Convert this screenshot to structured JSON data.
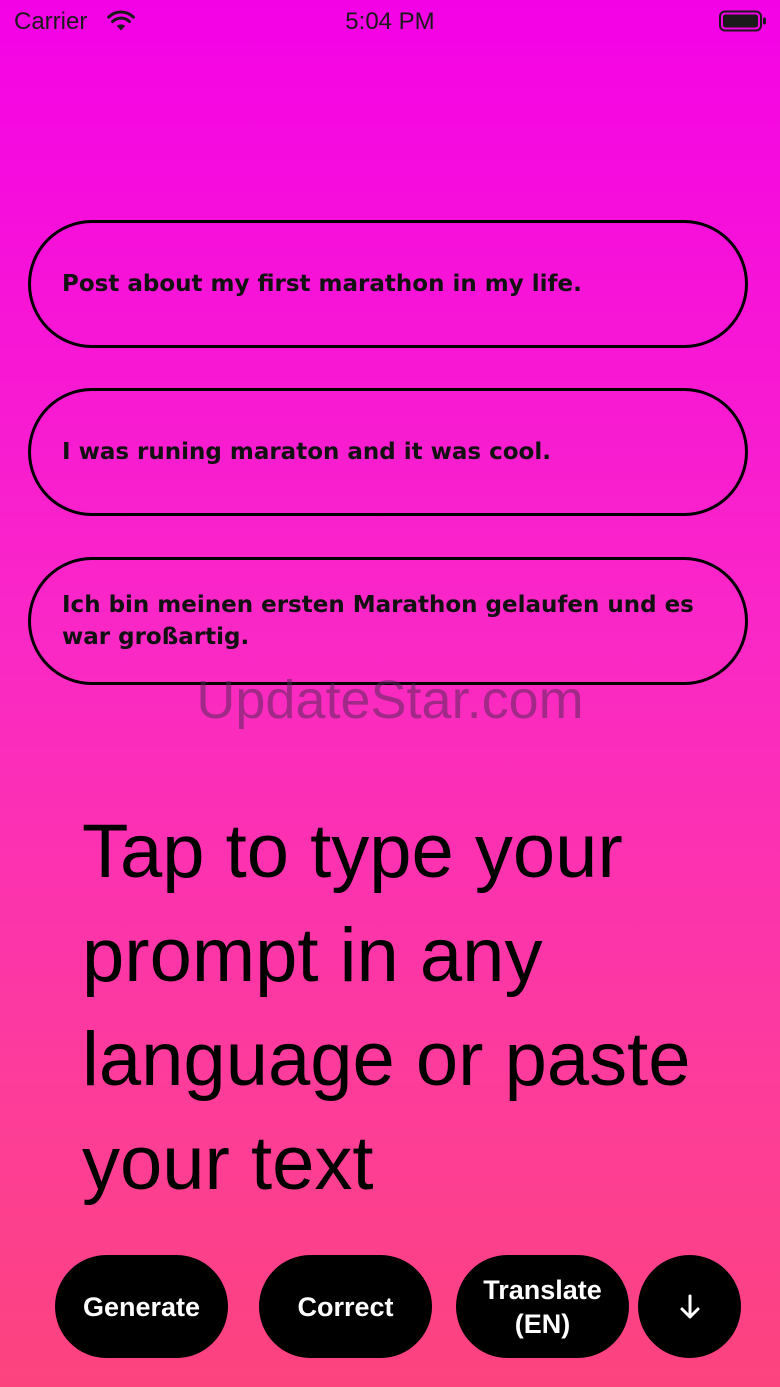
{
  "status_bar": {
    "carrier": "Carrier",
    "time": "5:04 PM"
  },
  "suggestions": [
    {
      "text": "Post about my first marathon in my life."
    },
    {
      "text": "I was runing maraton and it was cool."
    },
    {
      "text": "Ich bin meinen ersten Marathon gelaufen und es war großartig."
    }
  ],
  "watermark": "UpdateStar.com",
  "prompt": {
    "placeholder": "Tap to type your prompt in any language or paste your text"
  },
  "actions": {
    "generate": "Generate",
    "correct": "Correct",
    "translate_line1": "Translate",
    "translate_line2": "(EN)"
  },
  "icons": {
    "wifi": "wifi-icon",
    "battery": "battery-icon",
    "download": "arrow-down-icon"
  },
  "colors": {
    "gradient_top": "#f402e6",
    "gradient_bottom": "#fd437e",
    "button_bg": "#000000",
    "button_text": "#ffffff"
  }
}
